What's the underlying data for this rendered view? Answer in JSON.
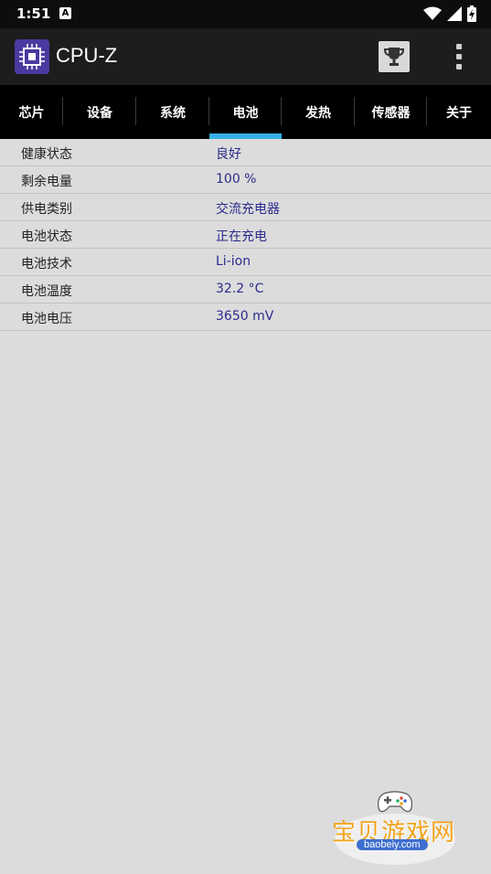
{
  "status": {
    "time": "1:51",
    "notif": "A"
  },
  "app": {
    "title": "CPU-Z"
  },
  "tabs": [
    {
      "label": "芯片"
    },
    {
      "label": "设备"
    },
    {
      "label": "系统"
    },
    {
      "label": "电池"
    },
    {
      "label": "发热"
    },
    {
      "label": "传感器"
    },
    {
      "label": "关于"
    }
  ],
  "battery": [
    {
      "label": "健康状态",
      "value": "良好"
    },
    {
      "label": "剩余电量",
      "value": "100 %"
    },
    {
      "label": "供电类别",
      "value": "交流充电器"
    },
    {
      "label": "电池状态",
      "value": "正在充电"
    },
    {
      "label": "电池技术",
      "value": "Li-ion"
    },
    {
      "label": "电池温度",
      "value": "32.2 °C"
    },
    {
      "label": "电池电压",
      "value": "3650 mV"
    }
  ],
  "watermark": {
    "brand": "宝贝游戏网",
    "site": "baobeiy.com"
  },
  "colors": {
    "accent": "#35b0e6",
    "value_text": "#2b2b8c",
    "logo": "#4a3aa0"
  },
  "icons": [
    "signal-icon",
    "wifi-icon",
    "battery-charging-icon",
    "trophy-icon",
    "more-vert-icon",
    "cpu-chip-icon"
  ]
}
